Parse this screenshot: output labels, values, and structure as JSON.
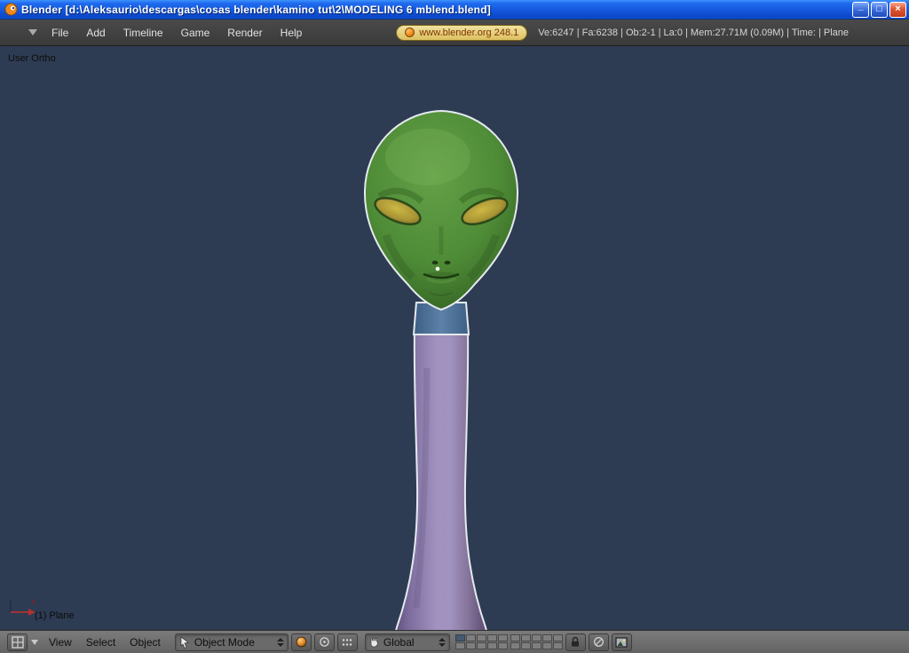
{
  "window": {
    "title": "Blender [d:\\Aleksaurio\\descargas\\cosas blender\\kamino tut\\2\\MODELING 6 mblend.blend]",
    "controls": {
      "minimize": "_",
      "maximize": "□",
      "close": "×"
    }
  },
  "top": {
    "menus": [
      "File",
      "Add",
      "Timeline",
      "Game",
      "Render",
      "Help"
    ],
    "badge": "www.blender.org 248.1",
    "stats": "Ve:6247 | Fa:6238 | Ob:2-1 | La:0 | Mem:27.71M (0.09M) | Time: | Plane"
  },
  "viewport": {
    "view_label": "User Ortho",
    "object_label": "(1) Plane",
    "axis_label": "x",
    "colors": {
      "background": "#2d3c52",
      "head_green": "#4f8c37",
      "neck_purple": "#8d7dae",
      "collar_blue": "#5c80a8",
      "eye_yellow": "#b3a03f",
      "selection_outline": "#e6e9f0",
      "axis_red": "#b03030"
    }
  },
  "bottom": {
    "menus": [
      "View",
      "Select",
      "Object"
    ],
    "mode": "Object Mode",
    "orientation": "Global"
  }
}
